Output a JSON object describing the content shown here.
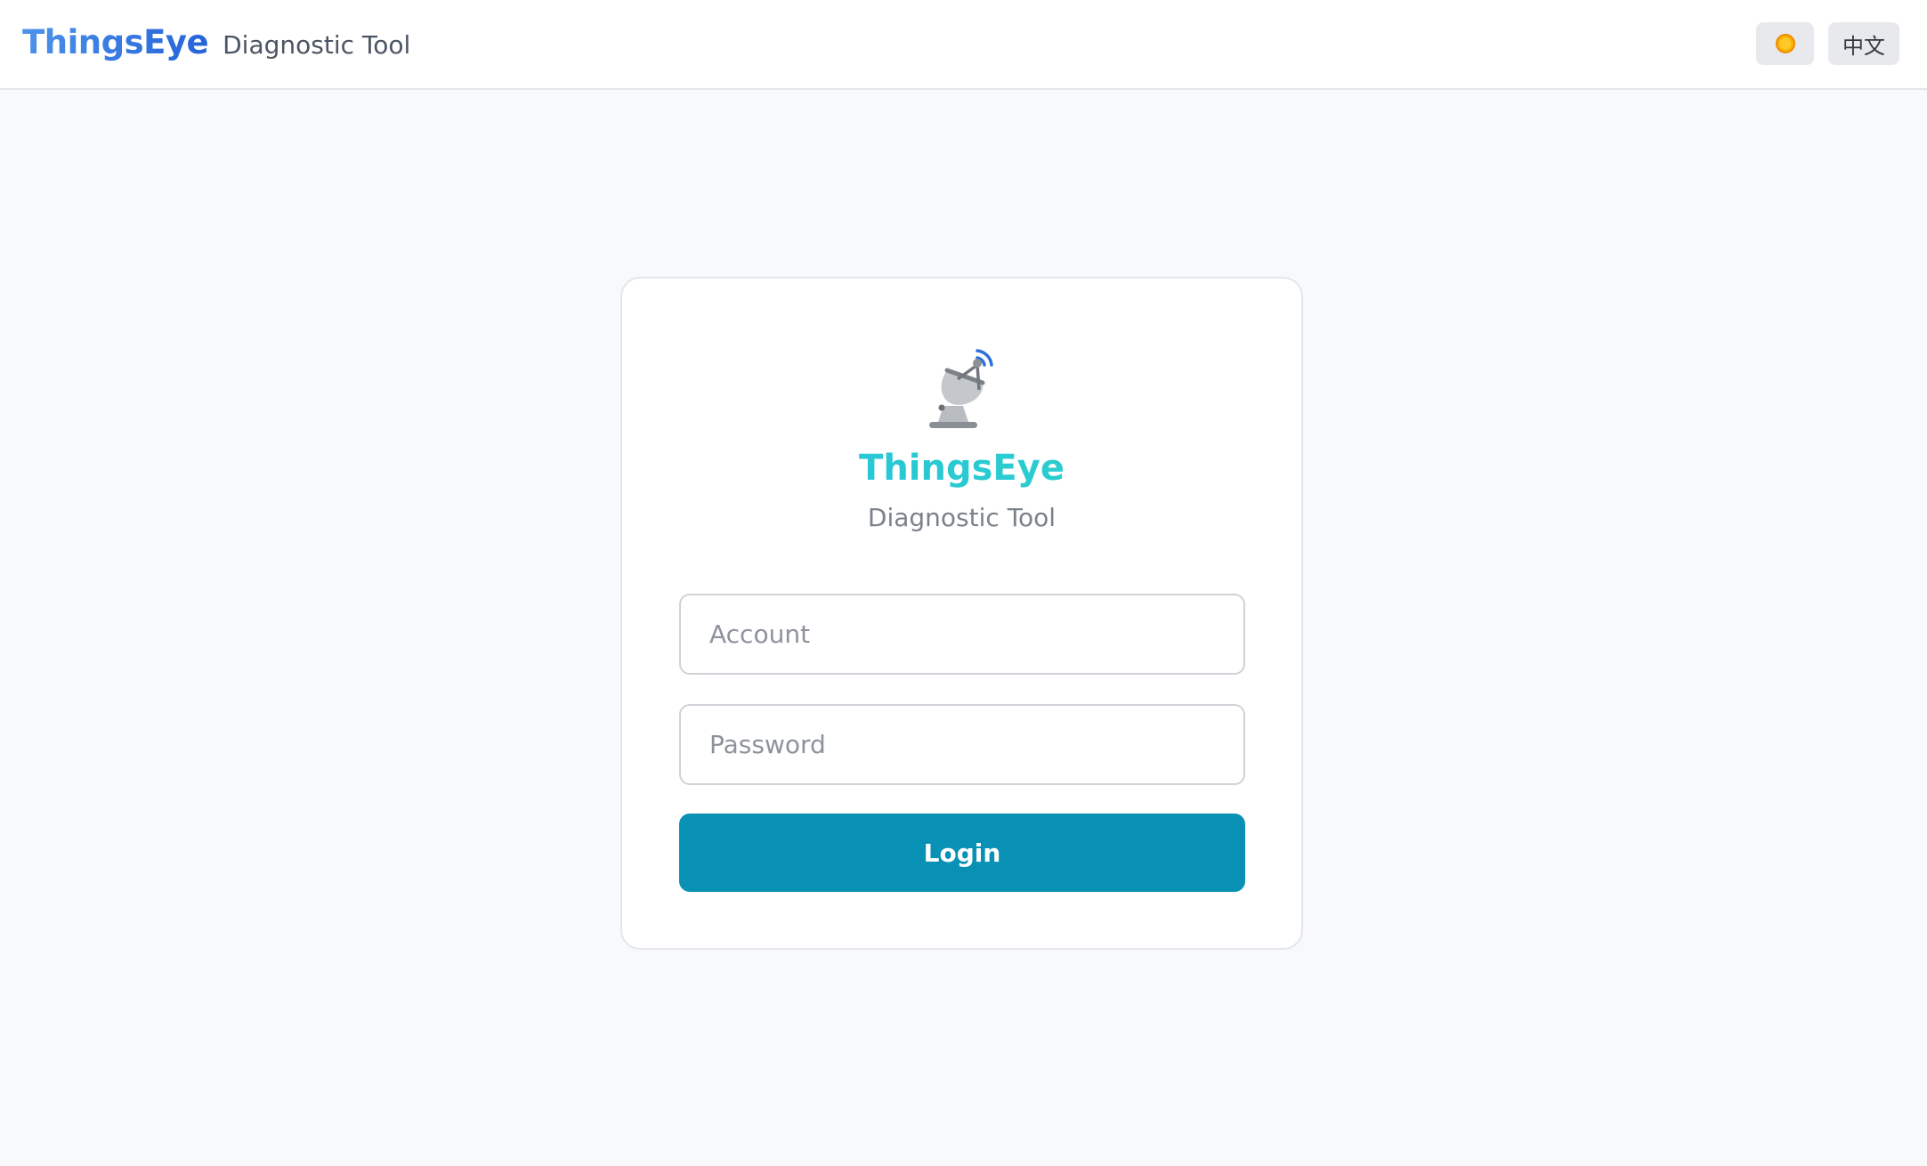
{
  "header": {
    "brand": "ThingsEye",
    "subtitle": "Diagnostic Tool",
    "theme_icon": "sun-icon",
    "language_label": "中文"
  },
  "login_card": {
    "logo_icon": "satellite-dish-icon",
    "title": "ThingsEye",
    "subtitle": "Diagnostic Tool",
    "account_placeholder": "Account",
    "password_placeholder": "Password",
    "login_label": "Login"
  },
  "colors": {
    "brand_blue": "#3b7fe3",
    "title_cyan": "#2ac7d6",
    "login_button": "#0891b4",
    "sun": "#f5a623"
  }
}
